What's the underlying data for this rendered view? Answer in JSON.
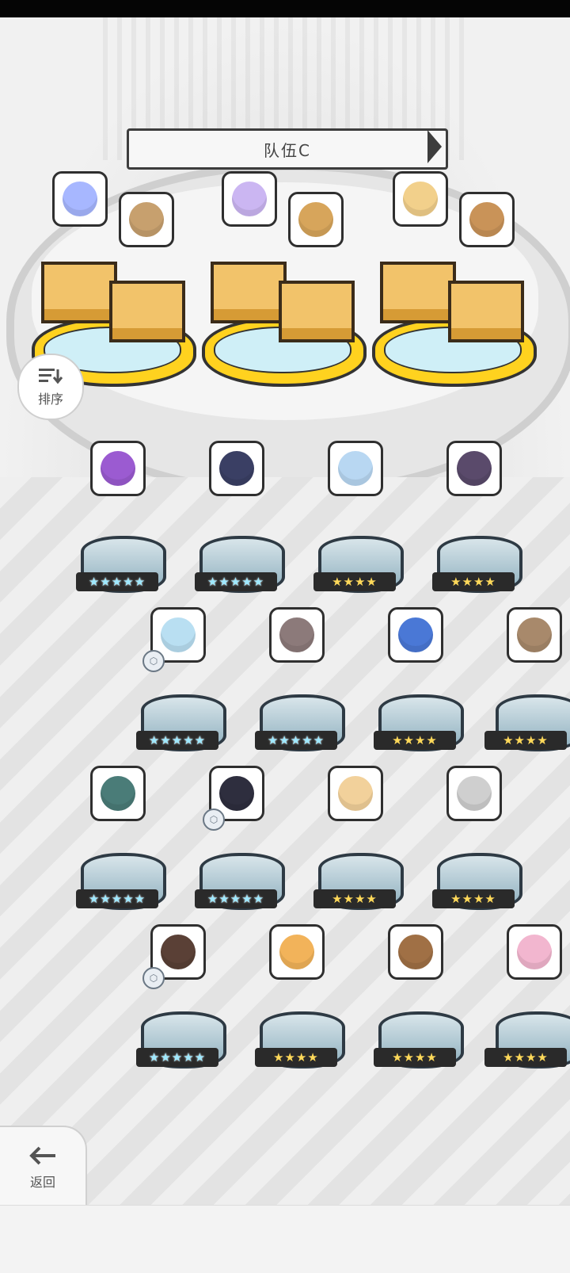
{
  "team": {
    "title": "队伍C"
  },
  "buttons": {
    "sort_label": "排序",
    "back_label": "返回"
  },
  "team_slots": [
    {
      "pair": [
        {
          "portrait_color": "#a7b7ff",
          "has_crown": true,
          "badge": "⚡"
        },
        {
          "portrait_color": "#c7a06e",
          "has_crown": true,
          "badge": "⚡"
        }
      ]
    },
    {
      "pair": [
        {
          "portrait_color": "#cbb6f2",
          "has_crown": true,
          "badge": "⚡"
        },
        {
          "portrait_color": "#d7a55b",
          "has_crown": true,
          "badge": "⚡"
        }
      ]
    },
    {
      "pair": [
        {
          "portrait_color": "#f2d08b",
          "has_crown": true,
          "badge": "⚡"
        },
        {
          "portrait_color": "#c99358",
          "has_crown": true,
          "badge": "⚡"
        }
      ]
    }
  ],
  "roster": [
    {
      "row": 1,
      "items": [
        {
          "stars": "★★★★★",
          "rainbow": true,
          "color": "#9b5bd1",
          "crown": true
        },
        {
          "stars": "★★★★★",
          "rainbow": true,
          "color": "#3a3f64",
          "crown": true
        },
        {
          "stars": "★★★★",
          "rainbow": false,
          "color": "#b8d7f2",
          "crown": true
        },
        {
          "stars": "★★★★",
          "rainbow": false,
          "color": "#5a4a6b",
          "crown": true
        }
      ]
    },
    {
      "row": 2,
      "items": [
        {
          "stars": "★★★★★",
          "rainbow": true,
          "color": "#b9dff2",
          "crown": true,
          "sidebadge": true
        },
        {
          "stars": "★★★★★",
          "rainbow": true,
          "color": "#8c7a7a",
          "crown": true
        },
        {
          "stars": "★★★★",
          "rainbow": false,
          "color": "#4a78d6",
          "crown": false
        },
        {
          "stars": "★★★★",
          "rainbow": false,
          "color": "#a8896b",
          "crown": false
        }
      ]
    },
    {
      "row": 3,
      "items": [
        {
          "stars": "★★★★★",
          "rainbow": true,
          "color": "#4a7c78",
          "crown": true
        },
        {
          "stars": "★★★★★",
          "rainbow": true,
          "color": "#2e2e3e",
          "crown": true,
          "sidebadge": true
        },
        {
          "stars": "★★★★",
          "rainbow": false,
          "color": "#f2d19b",
          "crown": false
        },
        {
          "stars": "★★★★",
          "rainbow": false,
          "color": "#cfcfcf",
          "crown": true
        }
      ]
    },
    {
      "row": 4,
      "items": [
        {
          "stars": "★★★★★",
          "rainbow": true,
          "color": "#5a4036",
          "crown": true,
          "sidebadge": true
        },
        {
          "stars": "★★★★",
          "rainbow": false,
          "color": "#f2b35a",
          "crown": false
        },
        {
          "stars": "★★★★",
          "rainbow": false,
          "color": "#a07045",
          "crown": false
        },
        {
          "stars": "★★★★",
          "rainbow": false,
          "color": "#f2b6cf",
          "crown": false
        }
      ]
    }
  ]
}
